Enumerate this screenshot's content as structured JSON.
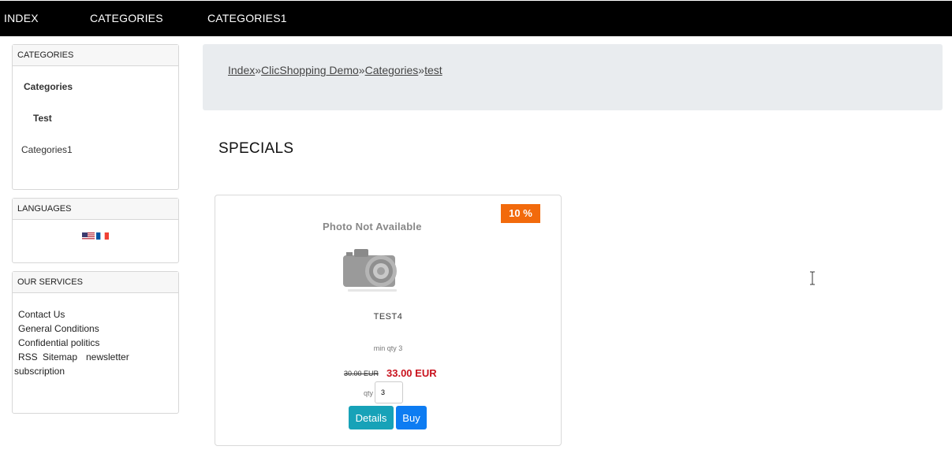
{
  "nav": {
    "items": [
      "INDEX",
      "CATEGORIES",
      "CATEGORIES1"
    ]
  },
  "sidebar": {
    "categories": {
      "title": "CATEGORIES",
      "items": [
        "Categories",
        "Test",
        "Categories1"
      ]
    },
    "languages": {
      "title": "LANGUAGES",
      "flags": [
        "us-flag-icon",
        "fr-flag-icon"
      ]
    },
    "services": {
      "title": "OUR SERVICES",
      "links": [
        "Contact Us",
        "General Conditions",
        "Confidential politics",
        "RSS",
        "Sitemap",
        "newsletter",
        "subscription"
      ]
    }
  },
  "breadcrumb": {
    "items": [
      "Index",
      "ClicShopping Demo",
      "Categories",
      "test"
    ],
    "separator": "»"
  },
  "specials": {
    "title": "SPECIALS",
    "product": {
      "badge": "10 %",
      "image_text": "Photo Not Available",
      "name": "TEST4",
      "min_qty": "min qty 3",
      "old_price": "30.00 EUR",
      "new_price": "33.00 EUR",
      "qty_label": "qty",
      "qty_value": "3",
      "details_label": "Details",
      "buy_label": "Buy"
    }
  },
  "colors": {
    "badge": "#f26a0c",
    "price": "#c9131e",
    "details_button": "#17a2b8",
    "buy_button": "#0d7cf2"
  }
}
